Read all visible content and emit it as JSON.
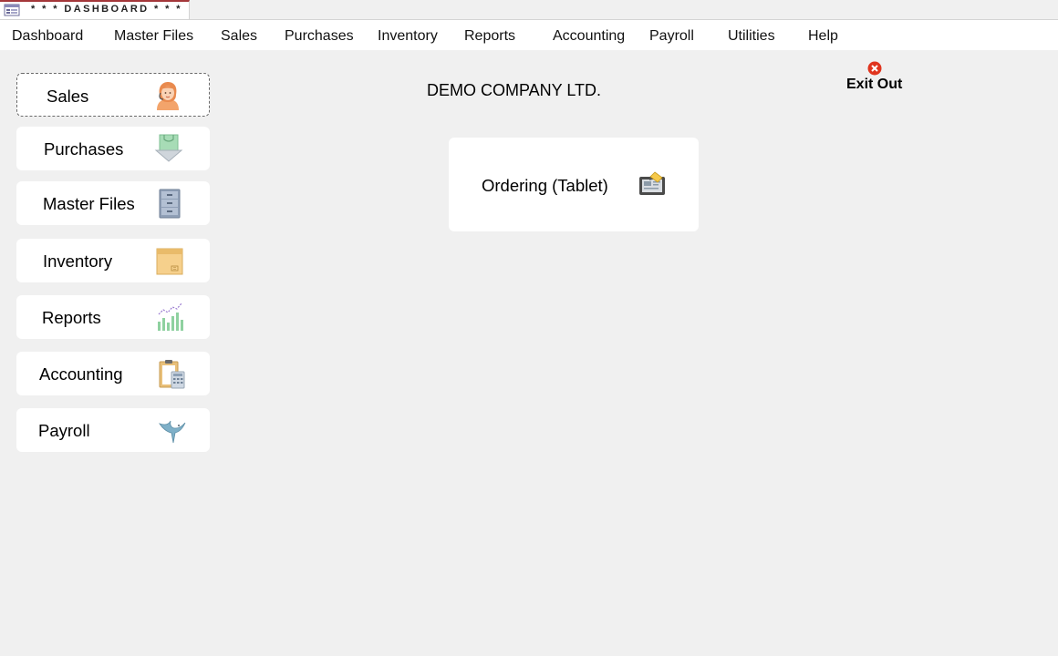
{
  "window": {
    "tab_title": "* * * DASHBOARD * * *",
    "tab_icon": "form-icon"
  },
  "menu": {
    "items": [
      {
        "label": "Dashboard"
      },
      {
        "label": "Master Files"
      },
      {
        "label": "Sales"
      },
      {
        "label": "Purchases"
      },
      {
        "label": "Inventory"
      },
      {
        "label": "Reports"
      },
      {
        "label": "Accounting"
      },
      {
        "label": "Payroll"
      },
      {
        "label": "Utilities"
      },
      {
        "label": "Help"
      }
    ]
  },
  "sidebar": {
    "buttons": [
      {
        "label": "Sales",
        "icon": "saleswoman-icon",
        "focused": true
      },
      {
        "label": "Purchases",
        "icon": "shopping-bag-icon"
      },
      {
        "label": "Master Files",
        "icon": "filing-cabinet-icon"
      },
      {
        "label": "Inventory",
        "icon": "box-icon"
      },
      {
        "label": "Reports",
        "icon": "bar-chart-icon"
      },
      {
        "label": "Accounting",
        "icon": "clipboard-calculator-icon"
      },
      {
        "label": "Payroll",
        "icon": "bird-icon"
      }
    ]
  },
  "main": {
    "company_name": "DEMO COMPANY LTD.",
    "exit": {
      "label": "Exit Out",
      "icon": "close-icon"
    },
    "ordering_button": {
      "label": "Ordering (Tablet)",
      "icon": "tablet-icon"
    }
  },
  "colors": {
    "background": "#f0f0f0",
    "panel": "#ffffff",
    "tab_accent": "#a4373a",
    "exit_red": "#e0341e"
  }
}
